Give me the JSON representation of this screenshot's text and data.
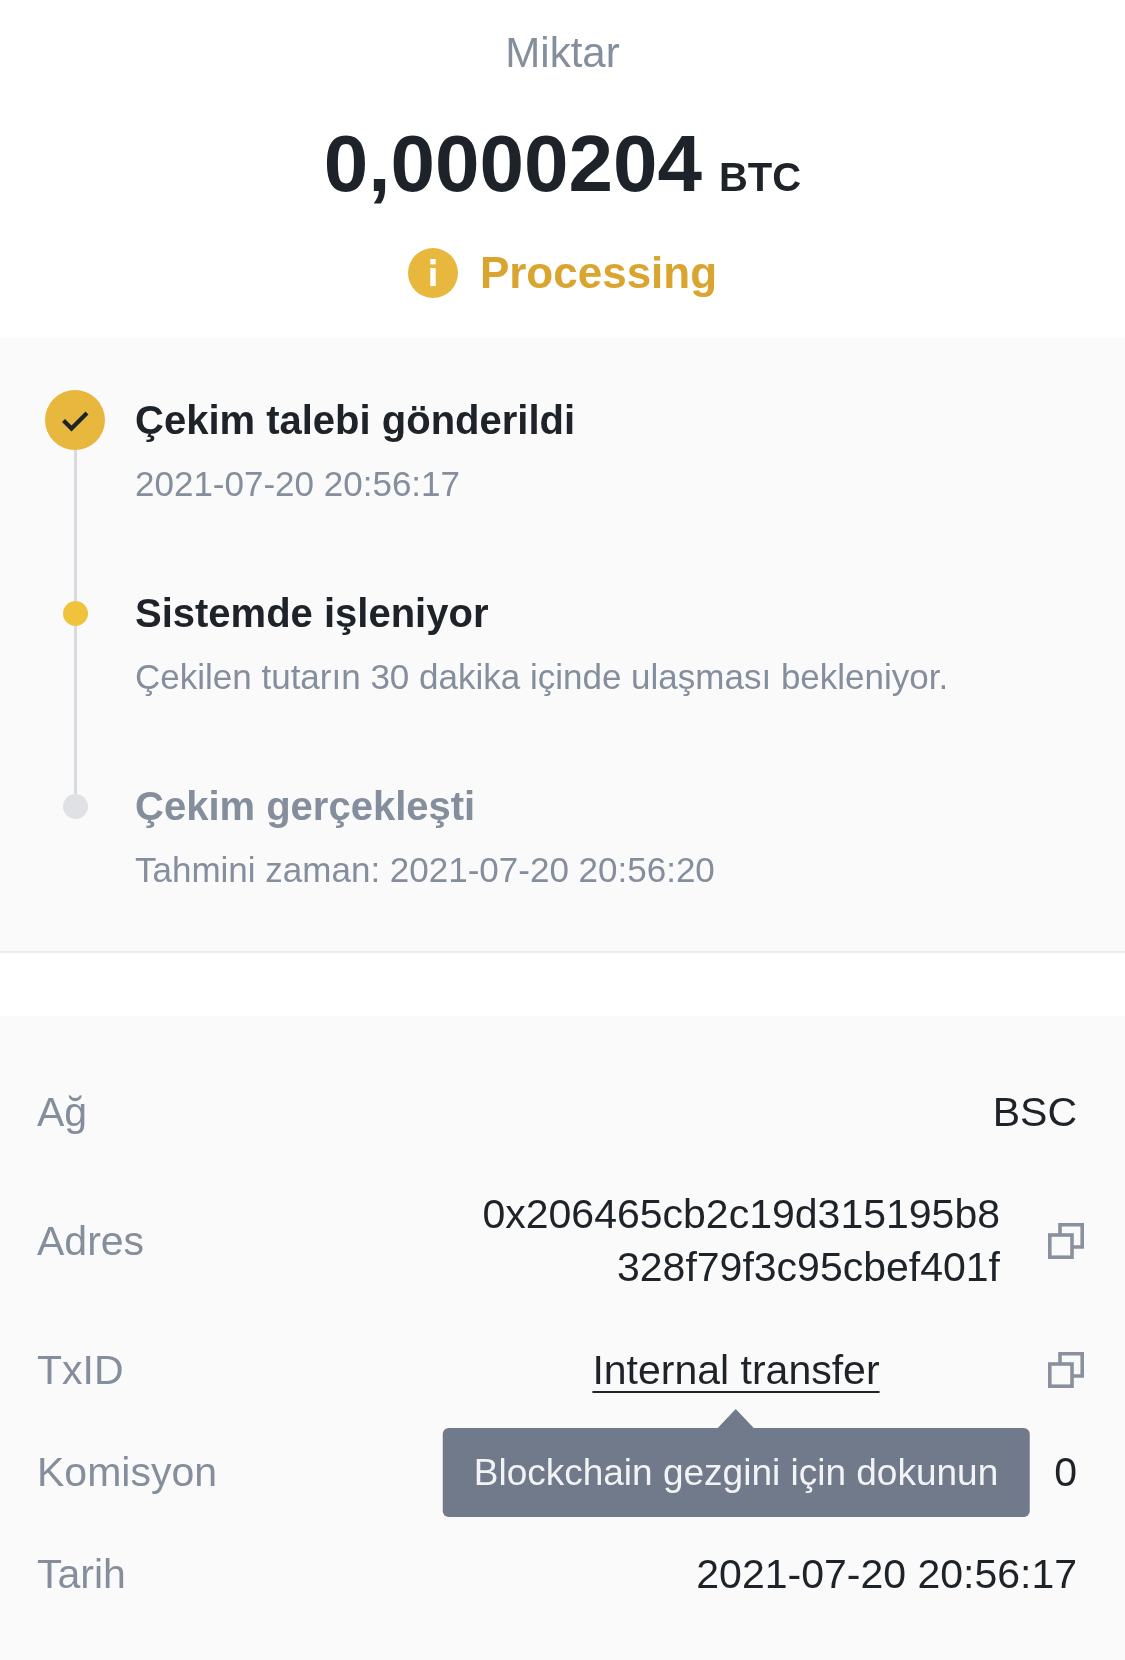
{
  "amount": {
    "label": "Miktar",
    "value": "0,0000204",
    "unit": "BTC"
  },
  "status": {
    "label": "Processing"
  },
  "timeline": [
    {
      "title": "Çekim talebi gönderildi",
      "detail": "2021-07-20 20:56:17",
      "completed": true,
      "current": false
    },
    {
      "title": "Sistemde işleniyor",
      "detail": "Çekilen tutarın 30 dakika içinde ulaşması bekleniyor.",
      "completed": false,
      "current": true
    },
    {
      "title": "Çekim gerçekleşti",
      "detail": "Tahmini zaman: 2021-07-20 20:56:20",
      "completed": false,
      "current": false
    }
  ],
  "details": [
    {
      "label": "Ağ",
      "value": "BSC",
      "kind": "plain"
    },
    {
      "label": "Adres",
      "value": "0x206465cb2c19d315195b8328f79f3c95cbef401f",
      "kind": "copy"
    },
    {
      "label": "TxID",
      "value": "Internal transfer",
      "kind": "link",
      "tooltip": "Blockchain gezgini için dokunun"
    },
    {
      "label": "Komisyon",
      "value": "0",
      "kind": "plain"
    },
    {
      "label": "Tarih",
      "value": "2021-07-20 20:56:17",
      "kind": "plain"
    }
  ]
}
